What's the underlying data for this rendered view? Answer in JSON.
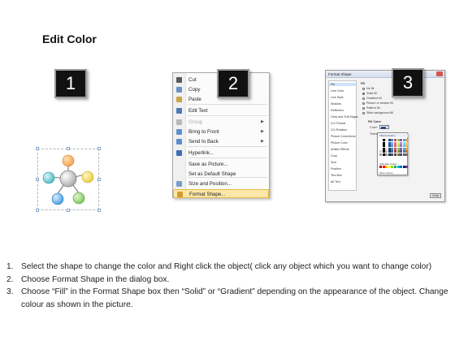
{
  "title": "Edit Color",
  "steps": [
    "1",
    "2",
    "3"
  ],
  "menu": {
    "items": [
      {
        "label": "Cut",
        "icon": "scissors-icon",
        "color": "#5a5a5a",
        "state": "normal",
        "submenu": false
      },
      {
        "label": "Copy",
        "icon": "copy-icon",
        "color": "#6b8fc7",
        "state": "normal",
        "submenu": false
      },
      {
        "label": "Paste",
        "icon": "paste-icon",
        "color": "#c9a54a",
        "state": "normal",
        "submenu": false
      },
      {
        "label": "Edit Text",
        "icon": "edit-text-icon",
        "color": "#4a78b8",
        "state": "normal",
        "submenu": false
      },
      {
        "label": "Group",
        "icon": "group-icon",
        "color": "#b8b8b8",
        "state": "disabled",
        "submenu": true
      },
      {
        "label": "Bring to Front",
        "icon": "bring-front-icon",
        "color": "#5d8fcf",
        "state": "normal",
        "submenu": true
      },
      {
        "label": "Send to Back",
        "icon": "send-back-icon",
        "color": "#5d8fcf",
        "state": "normal",
        "submenu": true
      },
      {
        "label": "Hyperlink...",
        "icon": "hyperlink-icon",
        "color": "#3b6fb5",
        "state": "normal",
        "submenu": false
      },
      {
        "label": "Save as Picture...",
        "icon": "",
        "color": "",
        "state": "normal",
        "submenu": false
      },
      {
        "label": "Set as Default Shape",
        "icon": "",
        "color": "",
        "state": "normal",
        "submenu": false
      },
      {
        "label": "Size and Position...",
        "icon": "size-position-icon",
        "color": "#7a9ccc",
        "state": "normal",
        "submenu": false
      },
      {
        "label": "Format Shape...",
        "icon": "format-shape-icon",
        "color": "#d49b2c",
        "state": "highlighted",
        "submenu": false
      }
    ]
  },
  "dialog": {
    "title": "Format Shape",
    "categories": [
      "Fill",
      "Line Color",
      "Line Style",
      "Shadow",
      "Reflection",
      "Glow and Soft Edges",
      "3-D Format",
      "3-D Rotation",
      "Picture Corrections",
      "Picture Color",
      "Artistic Effects",
      "Crop",
      "Size",
      "Position",
      "Text Box",
      "Alt Text"
    ],
    "active_category": "Fill",
    "fill_heading": "Fill",
    "fill_options": [
      {
        "label": "No fill",
        "selected": false
      },
      {
        "label": "Solid fill",
        "selected": true
      },
      {
        "label": "Gradient fill",
        "selected": false
      },
      {
        "label": "Picture or texture fill",
        "selected": false
      },
      {
        "label": "Pattern fill",
        "selected": false
      },
      {
        "label": "Slide background fill",
        "selected": false
      }
    ],
    "fill_color_heading": "Fill Color",
    "color_label": "Color:",
    "transparency_label": "Transpa",
    "theme_colors_label": "Theme Colors",
    "standard_colors_label": "Standard Colors",
    "more_colors_label": "More Colors...",
    "theme_colors": [
      "#ffffff",
      "#000000",
      "#eeece1",
      "#1f497d",
      "#4f81bd",
      "#c0504d",
      "#9bbb59",
      "#8064a2",
      "#4bacc6",
      "#f79646"
    ],
    "standard_colors": [
      "#c00000",
      "#ff0000",
      "#ffc000",
      "#ffff00",
      "#92d050",
      "#00b050",
      "#00b0f0",
      "#0070c0",
      "#002060",
      "#7030a0"
    ],
    "close_label": "Close"
  },
  "instructions": [
    {
      "num": "1.",
      "text": "Select the shape to change the color and Right click the object( click any object which you want to change color)"
    },
    {
      "num": "2.",
      "text": "Choose Format Shape in the dialog box."
    },
    {
      "num": "3.",
      "text": "Choose “Fill” in the Format Shape box then “Solid” or “Gradient” depending on the appearance of the object. Change colour as shown in the picture."
    }
  ]
}
